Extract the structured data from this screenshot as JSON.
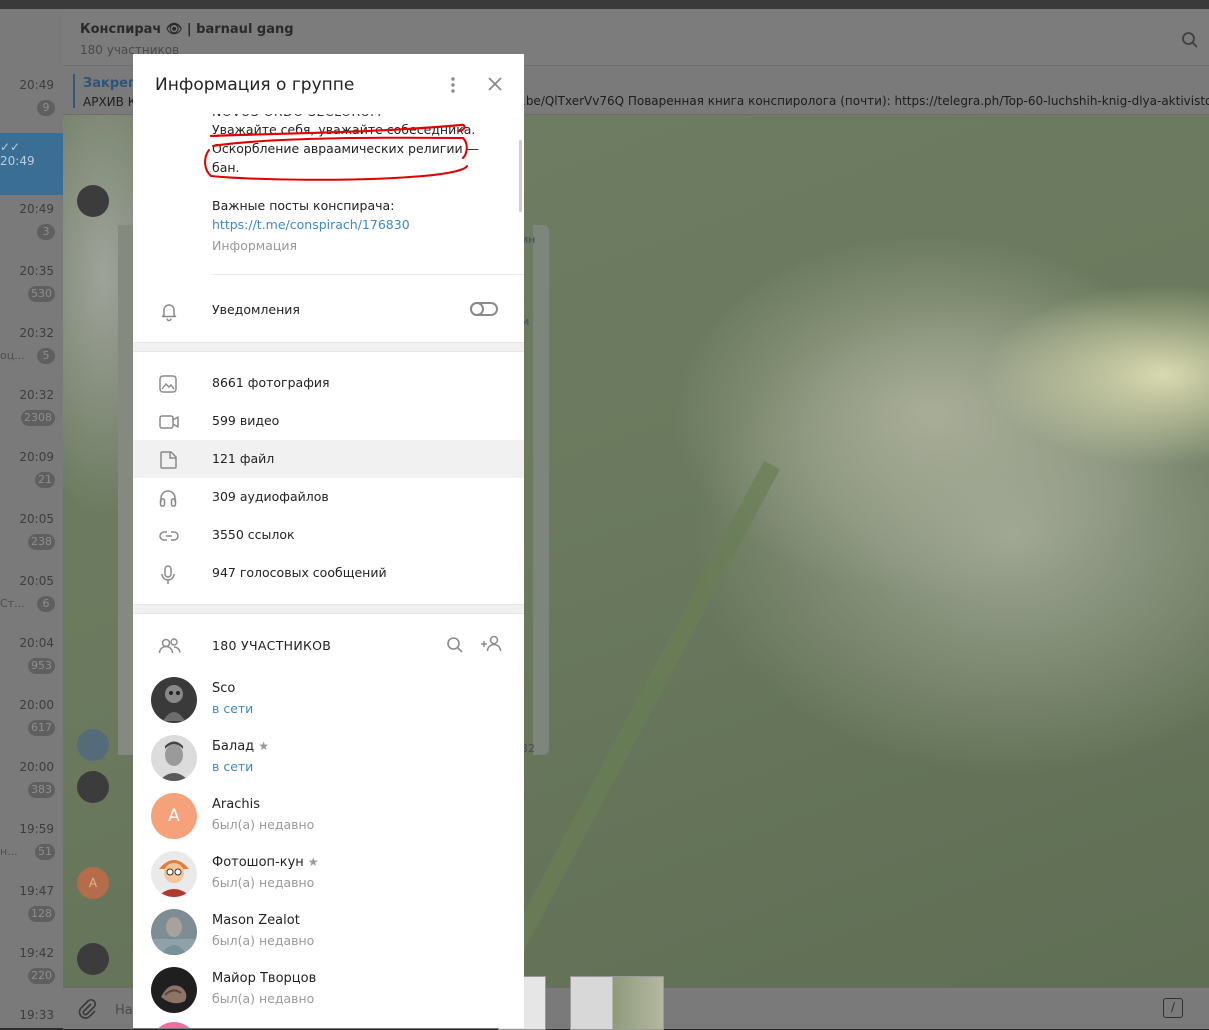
{
  "chat": {
    "title": "Конспирач 👁 | barnaul gang",
    "subtitle": "180 участников",
    "pinned_label": "Закрепл",
    "pinned_text": "АРХИВ К",
    "pinned_text_right": ".be/QlTxerVv76Q  Поваренная книга конспиролога (почти): https://telegra.ph/Top-60-luchshih-knig-dlya-aktivisto",
    "composer_placeholder": "На",
    "composer_cmd": "/",
    "right_snip_1": "ин",
    "right_snip_2": "м",
    "right_snip_3": "32"
  },
  "dialogs": [
    {
      "time": "20:49",
      "badge": "9",
      "snip": ""
    },
    {
      "time": "20:49",
      "badge": "",
      "snip": ""
    },
    {
      "time": "20:49",
      "badge": "3",
      "snip": ""
    },
    {
      "time": "20:35",
      "badge": "530",
      "snip": ""
    },
    {
      "time": "20:32",
      "badge": "5",
      "snip": "оц..."
    },
    {
      "time": "20:32",
      "badge": "2308",
      "snip": ""
    },
    {
      "time": "20:09",
      "badge": "21",
      "snip": ""
    },
    {
      "time": "20:05",
      "badge": "238",
      "snip": ""
    },
    {
      "time": "20:05",
      "badge": "6",
      "snip": "Ст..."
    },
    {
      "time": "20:04",
      "badge": "953",
      "snip": ""
    },
    {
      "time": "20:00",
      "badge": "617",
      "snip": ""
    },
    {
      "time": "20:00",
      "badge": "383",
      "snip": ""
    },
    {
      "time": "19:59",
      "badge": "51",
      "snip": "н..."
    },
    {
      "time": "19:47",
      "badge": "128",
      "snip": ""
    },
    {
      "time": "19:42",
      "badge": "220",
      "snip": ""
    },
    {
      "time": "19:33",
      "badge": "",
      "snip": ""
    }
  ],
  "modal": {
    "title": "Информация о группе",
    "desc_cut": "NOVUS ORDO SECLORUM",
    "desc_line1": "Уважайте себя, уважайте собеседника.",
    "desc_line2": "Оскорбление авраамических религии —",
    "desc_line3": "бан.",
    "important_label": "Важные посты конспирача:",
    "important_link": "https://t.me/conspirach/176830",
    "info_label": "Информация",
    "notifications_label": "Уведомления",
    "notifications_on": false,
    "media": [
      {
        "icon": "photo-icon",
        "label": "8661 фотография"
      },
      {
        "icon": "video-icon",
        "label": "599 видео"
      },
      {
        "icon": "file-icon",
        "label": "121 файл"
      },
      {
        "icon": "headphones-icon",
        "label": "309 аудиофайлов"
      },
      {
        "icon": "link-icon",
        "label": "3550 ссылок"
      },
      {
        "icon": "microphone-icon",
        "label": "947 голосовых сообщений"
      }
    ],
    "members_label": "180 УЧАСТНИКОВ",
    "members": [
      {
        "name": "Sco",
        "status": "в сети",
        "online": true,
        "star": false
      },
      {
        "name": "Балад",
        "status": "в сети",
        "online": true,
        "star": true
      },
      {
        "name": "Arachis",
        "status": "был(а) недавно",
        "online": false,
        "star": false,
        "initial": "A",
        "color": "#f5a27b"
      },
      {
        "name": "Фотошоп-кун",
        "status": "был(а) недавно",
        "online": false,
        "star": true
      },
      {
        "name": "Mason Zealot",
        "status": "был(а) недавно",
        "online": false,
        "star": false
      },
      {
        "name": "Майор Творцов",
        "status": "был(а) недавно",
        "online": false,
        "star": false
      }
    ]
  },
  "colors": {
    "link": "#3a89c9",
    "annotation": "#e00000",
    "overlay_dim": "#7a7a7a"
  }
}
